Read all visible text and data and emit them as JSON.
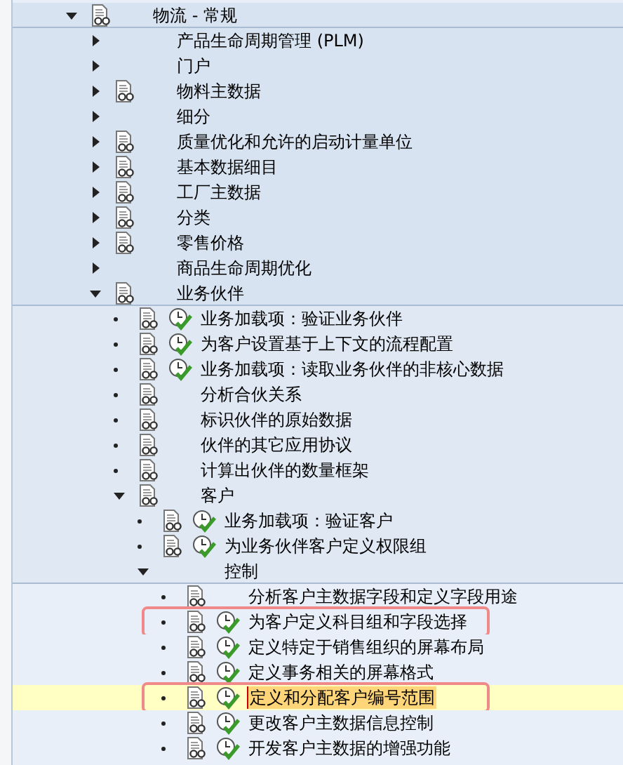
{
  "tree": [
    {
      "label": "物流 - 常规",
      "expanded": true,
      "doc": true,
      "activity": false,
      "selected": false,
      "marked": false,
      "children": [
        {
          "label": "产品生命周期管理 (PLM)",
          "expanded": false,
          "doc": false,
          "activity": false,
          "selected": false,
          "marked": false
        },
        {
          "label": "门户",
          "expanded": false,
          "doc": false,
          "activity": false,
          "selected": false,
          "marked": false
        },
        {
          "label": "物料主数据",
          "expanded": false,
          "doc": true,
          "activity": false,
          "selected": false,
          "marked": false
        },
        {
          "label": "细分",
          "expanded": false,
          "doc": false,
          "activity": false,
          "selected": false,
          "marked": false
        },
        {
          "label": "质量优化和允许的启动计量单位",
          "expanded": false,
          "doc": true,
          "activity": false,
          "selected": false,
          "marked": false
        },
        {
          "label": "基本数据细目",
          "expanded": false,
          "doc": true,
          "activity": false,
          "selected": false,
          "marked": false
        },
        {
          "label": "工厂主数据",
          "expanded": false,
          "doc": true,
          "activity": false,
          "selected": false,
          "marked": false
        },
        {
          "label": "分类",
          "expanded": false,
          "doc": true,
          "activity": false,
          "selected": false,
          "marked": false
        },
        {
          "label": "零售价格",
          "expanded": false,
          "doc": true,
          "activity": false,
          "selected": false,
          "marked": false
        },
        {
          "label": "商品生命周期优化",
          "expanded": false,
          "doc": false,
          "activity": false,
          "selected": false,
          "marked": false
        },
        {
          "label": "业务伙伴",
          "expanded": true,
          "doc": true,
          "activity": false,
          "selected": false,
          "marked": false,
          "children": [
            {
              "label": "业务加载项：验证业务伙伴",
              "doc": true,
              "activity": true,
              "selected": false,
              "marked": false
            },
            {
              "label": "为客户设置基于上下文的流程配置",
              "doc": true,
              "activity": true,
              "selected": false,
              "marked": false
            },
            {
              "label": "业务加载项：读取业务伙伴的非核心数据",
              "doc": true,
              "activity": true,
              "selected": false,
              "marked": false
            },
            {
              "label": "分析合伙关系",
              "doc": true,
              "activity": false,
              "selected": false,
              "marked": false
            },
            {
              "label": "标识伙伴的原始数据",
              "doc": true,
              "activity": false,
              "selected": false,
              "marked": false
            },
            {
              "label": "伙伴的其它应用协议",
              "doc": true,
              "activity": false,
              "selected": false,
              "marked": false
            },
            {
              "label": "计算出伙伴的数量框架",
              "doc": true,
              "activity": false,
              "selected": false,
              "marked": false
            },
            {
              "label": "客户",
              "expanded": true,
              "doc": true,
              "activity": false,
              "selected": false,
              "marked": false,
              "children": [
                {
                  "label": "业务加载项：验证客户",
                  "doc": true,
                  "activity": true,
                  "selected": false,
                  "marked": false
                },
                {
                  "label": "为业务伙伴客户定义权限组",
                  "doc": true,
                  "activity": true,
                  "selected": false,
                  "marked": false
                },
                {
                  "label": "控制",
                  "expanded": true,
                  "doc": false,
                  "activity": false,
                  "selected": false,
                  "marked": false,
                  "children": [
                    {
                      "label": "分析客户主数据字段和定义字段用途",
                      "doc": true,
                      "activity": false,
                      "selected": false,
                      "marked": false
                    },
                    {
                      "label": "为客户定义科目组和字段选择",
                      "doc": true,
                      "activity": true,
                      "selected": false,
                      "marked": true
                    },
                    {
                      "label": "定义特定于销售组织的屏幕布局",
                      "doc": true,
                      "activity": true,
                      "selected": false,
                      "marked": false
                    },
                    {
                      "label": "定义事务相关的屏幕格式",
                      "doc": true,
                      "activity": true,
                      "selected": false,
                      "marked": false
                    },
                    {
                      "label": "定义和分配客户编号范围",
                      "doc": true,
                      "activity": true,
                      "selected": true,
                      "marked": true
                    },
                    {
                      "label": "更改客户主数据信息控制",
                      "doc": true,
                      "activity": true,
                      "selected": false,
                      "marked": false
                    },
                    {
                      "label": "开发客户主数据的增强功能",
                      "doc": true,
                      "activity": true,
                      "selected": false,
                      "marked": false
                    }
                  ]
                }
              ]
            }
          ]
        }
      ]
    }
  ]
}
